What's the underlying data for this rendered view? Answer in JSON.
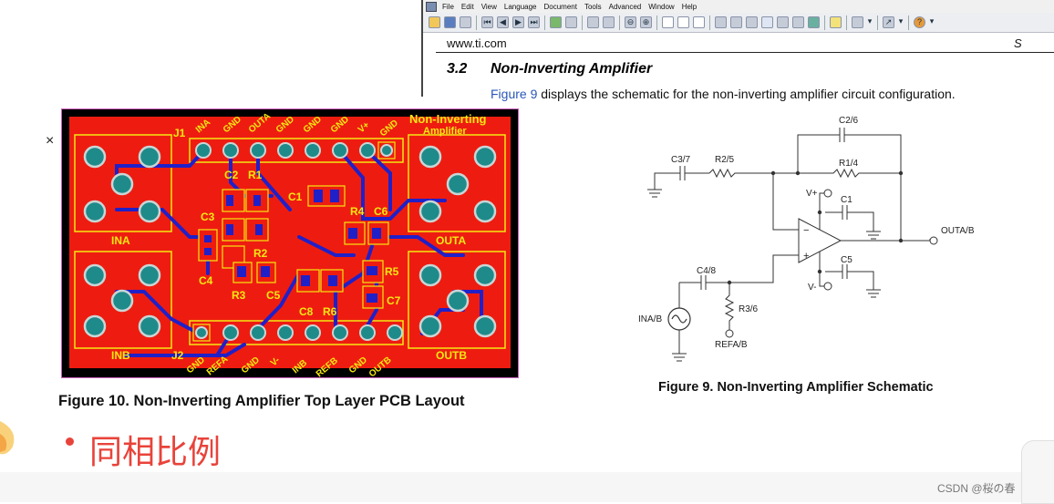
{
  "viewer": {
    "menu": [
      "File",
      "Edit",
      "View",
      "Language",
      "Document",
      "Tools",
      "Advanced",
      "Window",
      "Help"
    ],
    "toolbar_icons": [
      "open-icon",
      "save-icon",
      "print-icon",
      "first-page-icon",
      "prev-page-icon",
      "next-page-icon",
      "last-page-icon",
      "back-icon",
      "forward-icon",
      "copy-icon",
      "paste-icon",
      "zoom-out-icon",
      "zoom-in-icon",
      "single-page-icon",
      "continuous-icon",
      "facing-icon",
      "find-icon",
      "table-icon",
      "form-icon",
      "hand-icon",
      "text-select-icon",
      "snapshot-icon",
      "image-icon",
      "select-icon",
      "comment-icon",
      "arrow-tool-icon",
      "help-icon"
    ],
    "url": "www.ti.com",
    "url_right": "S",
    "section_number": "3.2",
    "section_title": "Non-Inverting Amplifier",
    "body_link": "Figure 9",
    "body_text": " displays the schematic for the non-inverting amplifier circuit configuration."
  },
  "pcb": {
    "caption": "Figure 10. Non-Inverting Amplifier Top Layer PCB Layout",
    "title_line1": "Non-Inverting",
    "title_line2": "Amplifier",
    "j1": "J1",
    "j2": "J2",
    "top_pins": [
      "INA",
      "GND",
      "OUTA",
      "GND",
      "GND",
      "GND",
      "V+",
      "GND"
    ],
    "bottom_pins": [
      "GND",
      "REFA",
      "GND",
      "V-",
      "INB",
      "REFB",
      "GND",
      "OUTB"
    ],
    "components": [
      "C2",
      "R1",
      "C1",
      "C3",
      "R4",
      "C6",
      "R2",
      "C4",
      "R5",
      "R3",
      "C5",
      "C7",
      "C8",
      "R6"
    ],
    "ports": [
      "INA",
      "OUTA",
      "INB",
      "OUTB"
    ]
  },
  "schematic": {
    "caption": "Figure 9. Non-Inverting Amplifier Schematic",
    "labels": {
      "c37": "C3/7",
      "r25": "R2/5",
      "c26": "C2/6",
      "r14": "R1/4",
      "vplus": "V+",
      "c1": "C1",
      "outab": "OUTA/B",
      "c48": "C4/8",
      "c5": "C5",
      "vminus": "V-",
      "r36": "R3/6",
      "inab": "INA/B",
      "refab": "REFA/B",
      "minus": "−",
      "plus": "+"
    }
  },
  "slide": {
    "bullet_text": "同相比例",
    "close_symbol": "×",
    "watermark": "CSDN @桜の春"
  },
  "colors": {
    "pcb_board": "#ee1c10",
    "pcb_silk": "#f4e812",
    "pcb_trace": "#2020c8",
    "pcb_pad": "#1f8a8a",
    "accent_red": "#e8433a"
  }
}
